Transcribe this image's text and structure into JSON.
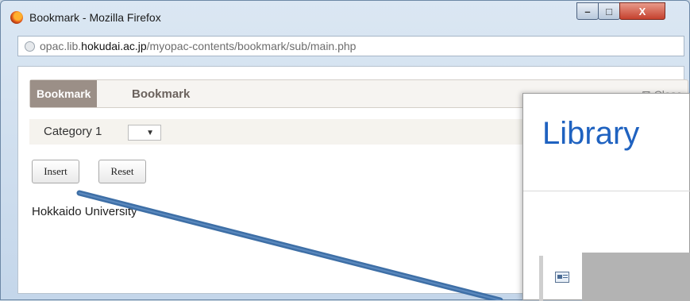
{
  "window": {
    "title": "Bookmark - Mozilla Firefox",
    "controls": {
      "minimize": "–",
      "maximize": "□",
      "close": "X"
    }
  },
  "urlbar": {
    "prefix": "opac.lib.",
    "domain": "hokudai.ac.jp",
    "path": "/myopac-contents/bookmark/sub/main.php"
  },
  "bookmark": {
    "tag": "Bookmark",
    "title": "Bookmark",
    "close_label": "Close",
    "category_label": "Category 1",
    "category_value": "",
    "insert_label": "Insert",
    "reset_label": "Reset",
    "item": "Hokkaido University"
  },
  "overlay": {
    "title": "Library"
  },
  "colors": {
    "arrow": "#3e6fa6",
    "library_title": "#1f62c0",
    "bookmark_tag": "#9b8f87"
  }
}
